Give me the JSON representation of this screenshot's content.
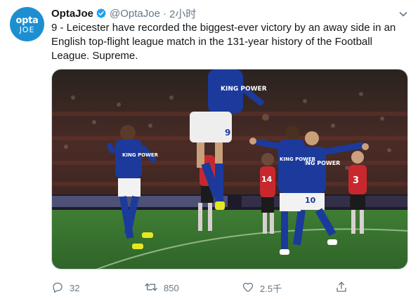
{
  "tweet": {
    "avatar": {
      "line1": "opta",
      "line2": "JOE"
    },
    "display_name": "OptaJoe",
    "handle": "@OptaJoe",
    "separator": "·",
    "timestamp": "2小时",
    "text": "9 - Leicester have recorded the biggest-ever victory by an away side in an English top-flight league match in the 131-year history of the Football League. Supreme."
  },
  "media": {
    "kit_text": "KING POWER",
    "shirt_numbers": [
      "9",
      "10",
      "3",
      "14"
    ]
  },
  "actions": {
    "reply_count": "32",
    "retweet_count": "850",
    "like_count": "2.5千"
  },
  "colors": {
    "brand_blue": "#1da1f2",
    "avatar_bg": "#1d8fd0",
    "leicester_blue": "#1b3a9c",
    "pitch_green": "#3f7d34",
    "meta_gray": "#657786"
  }
}
